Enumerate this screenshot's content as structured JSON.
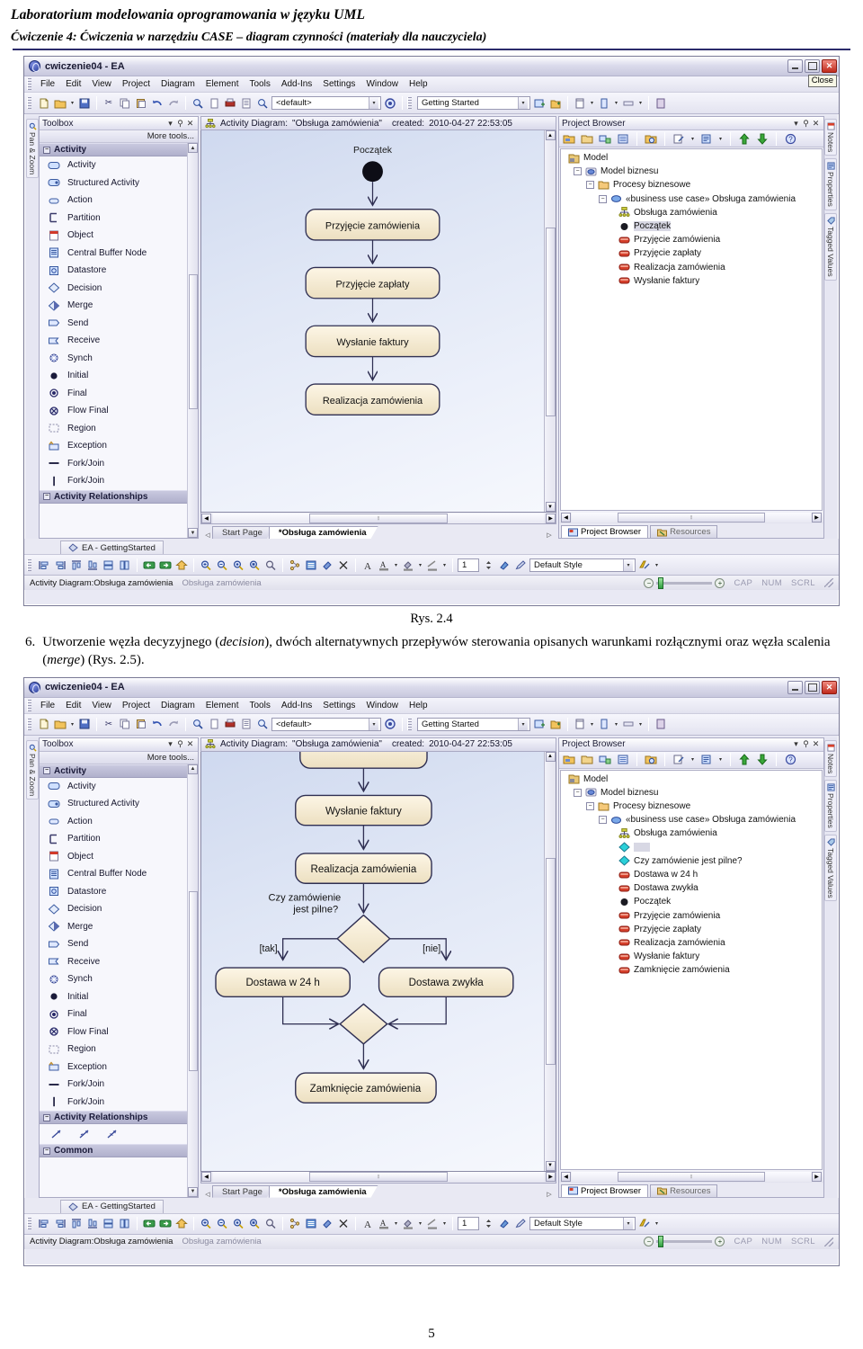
{
  "document": {
    "title": "Laboratorium modelowania oprogramowania w języku UML",
    "subtitle": "Ćwiczenie 4: Ćwiczenia w narzędziu CASE – diagram czynności (materiały dla nauczyciela)",
    "figure_caption_1": "Rys. 2.4",
    "step": {
      "number": "6.",
      "text_part1": "Utworzenie węzła decyzyjnego (",
      "italic1": "decision",
      "text_part2": "), dwóch alternatywnych przepływów sterowania opisanych warunkami rozłącznymi oraz węzła scalenia (",
      "italic2": "merge",
      "text_part3": ") (Rys. 2.5)."
    },
    "page_number": "5"
  },
  "app": {
    "window_title": "cwiczenie04 - EA",
    "close_tooltip": "Close",
    "menu": [
      "File",
      "Edit",
      "View",
      "Project",
      "Diagram",
      "Element",
      "Tools",
      "Add-Ins",
      "Settings",
      "Window",
      "Help"
    ],
    "toolbar": {
      "style_combo_value": "<default>",
      "perspective_combo_value": "Getting Started"
    },
    "left_vtab": "Pan & Zoom",
    "right_vtabs": [
      "Notes",
      "Properties",
      "Tagged Values"
    ],
    "toolbox": {
      "title": "Toolbox",
      "more_tools": "More tools...",
      "groups": [
        {
          "name": "Activity",
          "items": [
            {
              "label": "Activity",
              "icon": "rounded-rect-icon"
            },
            {
              "label": "Structured Activity",
              "icon": "structured-activity-icon"
            },
            {
              "label": "Action",
              "icon": "action-oval-icon"
            },
            {
              "label": "Partition",
              "icon": "partition-icon"
            },
            {
              "label": "Object",
              "icon": "object-icon"
            },
            {
              "label": "Central Buffer Node",
              "icon": "central-buffer-icon"
            },
            {
              "label": "Datastore",
              "icon": "datastore-icon"
            },
            {
              "label": "Decision",
              "icon": "diamond-icon"
            },
            {
              "label": "Merge",
              "icon": "merge-diamond-icon"
            },
            {
              "label": "Send",
              "icon": "send-icon"
            },
            {
              "label": "Receive",
              "icon": "receive-icon"
            },
            {
              "label": "Synch",
              "icon": "synch-icon"
            },
            {
              "label": "Initial",
              "icon": "initial-node-icon"
            },
            {
              "label": "Final",
              "icon": "final-node-icon"
            },
            {
              "label": "Flow Final",
              "icon": "flow-final-icon"
            },
            {
              "label": "Region",
              "icon": "region-icon"
            },
            {
              "label": "Exception",
              "icon": "exception-icon"
            },
            {
              "label": "Fork/Join",
              "icon": "fork-horizontal-icon"
            },
            {
              "label": "Fork/Join",
              "icon": "fork-vertical-icon"
            }
          ]
        },
        {
          "name": "Activity Relationships",
          "items": []
        },
        {
          "name": "Common",
          "items": []
        }
      ]
    },
    "diagram_header": {
      "label": "Activity Diagram:",
      "name": "\"Obsługa zamówienia\"",
      "created_label": "created:",
      "created_value": "2010-04-27 22:53:05"
    },
    "diagram_tabs": [
      {
        "label": "Start Page",
        "active": false
      },
      {
        "label": "*Obsługa zamówienia",
        "active": true
      }
    ],
    "project_browser": {
      "title": "Project Browser",
      "tabs": [
        {
          "label": "Project Browser",
          "active": true
        },
        {
          "label": "Resources",
          "active": false
        }
      ],
      "tree_1": [
        {
          "depth": 0,
          "label": "Model",
          "icon": "model-root-icon",
          "expander": "none",
          "selected": false
        },
        {
          "depth": 1,
          "label": "Model biznesu",
          "icon": "package-blue-icon",
          "expander": "minus",
          "selected": false
        },
        {
          "depth": 2,
          "label": "Procesy biznesowe",
          "icon": "folder-icon",
          "expander": "minus",
          "selected": false
        },
        {
          "depth": 3,
          "label": "«business use case» Obsługa zamówienia",
          "icon": "use-case-icon",
          "expander": "minus",
          "selected": false
        },
        {
          "depth": 4,
          "label": "Obsługa zamówienia",
          "icon": "activity-diagram-icon",
          "expander": "none",
          "selected": false
        },
        {
          "depth": 4,
          "label": "Początek",
          "icon": "initial-node-icon",
          "expander": "none",
          "selected": true
        },
        {
          "depth": 4,
          "label": "Przyjęcie zamówienia",
          "icon": "action-red-icon",
          "expander": "none",
          "selected": false
        },
        {
          "depth": 4,
          "label": "Przyjęcie zapłaty",
          "icon": "action-red-icon",
          "expander": "none",
          "selected": false
        },
        {
          "depth": 4,
          "label": "Realizacja zamówienia",
          "icon": "action-red-icon",
          "expander": "none",
          "selected": false
        },
        {
          "depth": 4,
          "label": "Wysłanie faktury",
          "icon": "action-red-icon",
          "expander": "none",
          "selected": false
        }
      ],
      "tree_2": [
        {
          "depth": 0,
          "label": "Model",
          "icon": "model-root-icon",
          "expander": "none",
          "selected": false
        },
        {
          "depth": 1,
          "label": "Model biznesu",
          "icon": "package-blue-icon",
          "expander": "minus",
          "selected": false
        },
        {
          "depth": 2,
          "label": "Procesy biznesowe",
          "icon": "folder-icon",
          "expander": "minus",
          "selected": false
        },
        {
          "depth": 3,
          "label": "«business use case» Obsługa zamówienia",
          "icon": "use-case-icon",
          "expander": "minus",
          "selected": false
        },
        {
          "depth": 4,
          "label": "Obsługa zamówienia",
          "icon": "activity-diagram-icon",
          "expander": "none",
          "selected": false
        },
        {
          "depth": 4,
          "label": "",
          "icon": "decision-cyan-icon",
          "expander": "none",
          "selected": true
        },
        {
          "depth": 4,
          "label": "Czy zamówienie jest pilne?",
          "icon": "decision-cyan-icon",
          "expander": "none",
          "selected": false
        },
        {
          "depth": 4,
          "label": "Dostawa w 24 h",
          "icon": "action-red-icon",
          "expander": "none",
          "selected": false
        },
        {
          "depth": 4,
          "label": "Dostawa zwykła",
          "icon": "action-red-icon",
          "expander": "none",
          "selected": false
        },
        {
          "depth": 4,
          "label": "Początek",
          "icon": "initial-node-icon",
          "expander": "none",
          "selected": false
        },
        {
          "depth": 4,
          "label": "Przyjęcie zamówienia",
          "icon": "action-red-icon",
          "expander": "none",
          "selected": false
        },
        {
          "depth": 4,
          "label": "Przyjęcie zapłaty",
          "icon": "action-red-icon",
          "expander": "none",
          "selected": false
        },
        {
          "depth": 4,
          "label": "Realizacja zamówienia",
          "icon": "action-red-icon",
          "expander": "none",
          "selected": false
        },
        {
          "depth": 4,
          "label": "Wysłanie faktury",
          "icon": "action-red-icon",
          "expander": "none",
          "selected": false
        },
        {
          "depth": 4,
          "label": "Zamknięcie zamówienia",
          "icon": "action-red-icon",
          "expander": "none",
          "selected": false
        }
      ]
    },
    "ea_doc_tab": "EA - GettingStarted",
    "bottom_toolbar": {
      "font_size_value": "1",
      "style_combo_value": "Default Style"
    },
    "statusbar": {
      "left": "Activity Diagram:Obsługa zamówienia",
      "secondary": "Obsługa zamówienia",
      "indicators": [
        "CAP",
        "NUM",
        "SCRL"
      ],
      "zoom_minus": "−",
      "zoom_plus": "+"
    }
  },
  "diagram_1": {
    "type": "uml-activity-diagram",
    "nodes": [
      {
        "id": "start",
        "kind": "initial",
        "label": "Początek"
      },
      {
        "id": "a1",
        "kind": "action",
        "label": "Przyjęcie zamówienia"
      },
      {
        "id": "a2",
        "kind": "action",
        "label": "Przyjęcie zapłaty"
      },
      {
        "id": "a3",
        "kind": "action",
        "label": "Wysłanie faktury"
      },
      {
        "id": "a4",
        "kind": "action",
        "label": "Realizacja zamówienia"
      }
    ],
    "edges": [
      {
        "from": "start",
        "to": "a1",
        "guard": ""
      },
      {
        "from": "a1",
        "to": "a2",
        "guard": ""
      },
      {
        "from": "a2",
        "to": "a3",
        "guard": ""
      },
      {
        "from": "a3",
        "to": "a4",
        "guard": ""
      }
    ]
  },
  "diagram_2": {
    "type": "uml-activity-diagram",
    "nodes": [
      {
        "id": "a0",
        "kind": "action",
        "label": ""
      },
      {
        "id": "a3",
        "kind": "action",
        "label": "Wysłanie faktury"
      },
      {
        "id": "a4",
        "kind": "action",
        "label": "Realizacja zamówienia"
      },
      {
        "id": "d1",
        "kind": "decision",
        "label": "Czy zamówienie\njest pilne?"
      },
      {
        "id": "b1",
        "kind": "action",
        "label": "Dostawa w 24 h"
      },
      {
        "id": "b2",
        "kind": "action",
        "label": "Dostawa zwykła"
      },
      {
        "id": "m1",
        "kind": "merge",
        "label": ""
      },
      {
        "id": "a5",
        "kind": "action",
        "label": "Zamknięcie zamówienia"
      }
    ],
    "edges": [
      {
        "from": "a0",
        "to": "a3",
        "guard": ""
      },
      {
        "from": "a3",
        "to": "a4",
        "guard": ""
      },
      {
        "from": "a4",
        "to": "d1",
        "guard": ""
      },
      {
        "from": "d1",
        "to": "b1",
        "guard": "[tak]"
      },
      {
        "from": "d1",
        "to": "b2",
        "guard": "[nie]"
      },
      {
        "from": "b1",
        "to": "m1",
        "guard": ""
      },
      {
        "from": "b2",
        "to": "m1",
        "guard": ""
      },
      {
        "from": "m1",
        "to": "a5",
        "guard": ""
      }
    ],
    "decision_label": "Czy zamówienie jest pilne?",
    "guards": [
      "[tak]",
      "[nie]"
    ]
  },
  "colors": {
    "action_fill": "#f6ecd4",
    "action_stroke": "#3a3a5a",
    "canvas_top": "#cfd9ef",
    "canvas_bottom": "#f6f8fd",
    "close_red": "#c02a1c",
    "group_header": "#b0b0cc"
  }
}
